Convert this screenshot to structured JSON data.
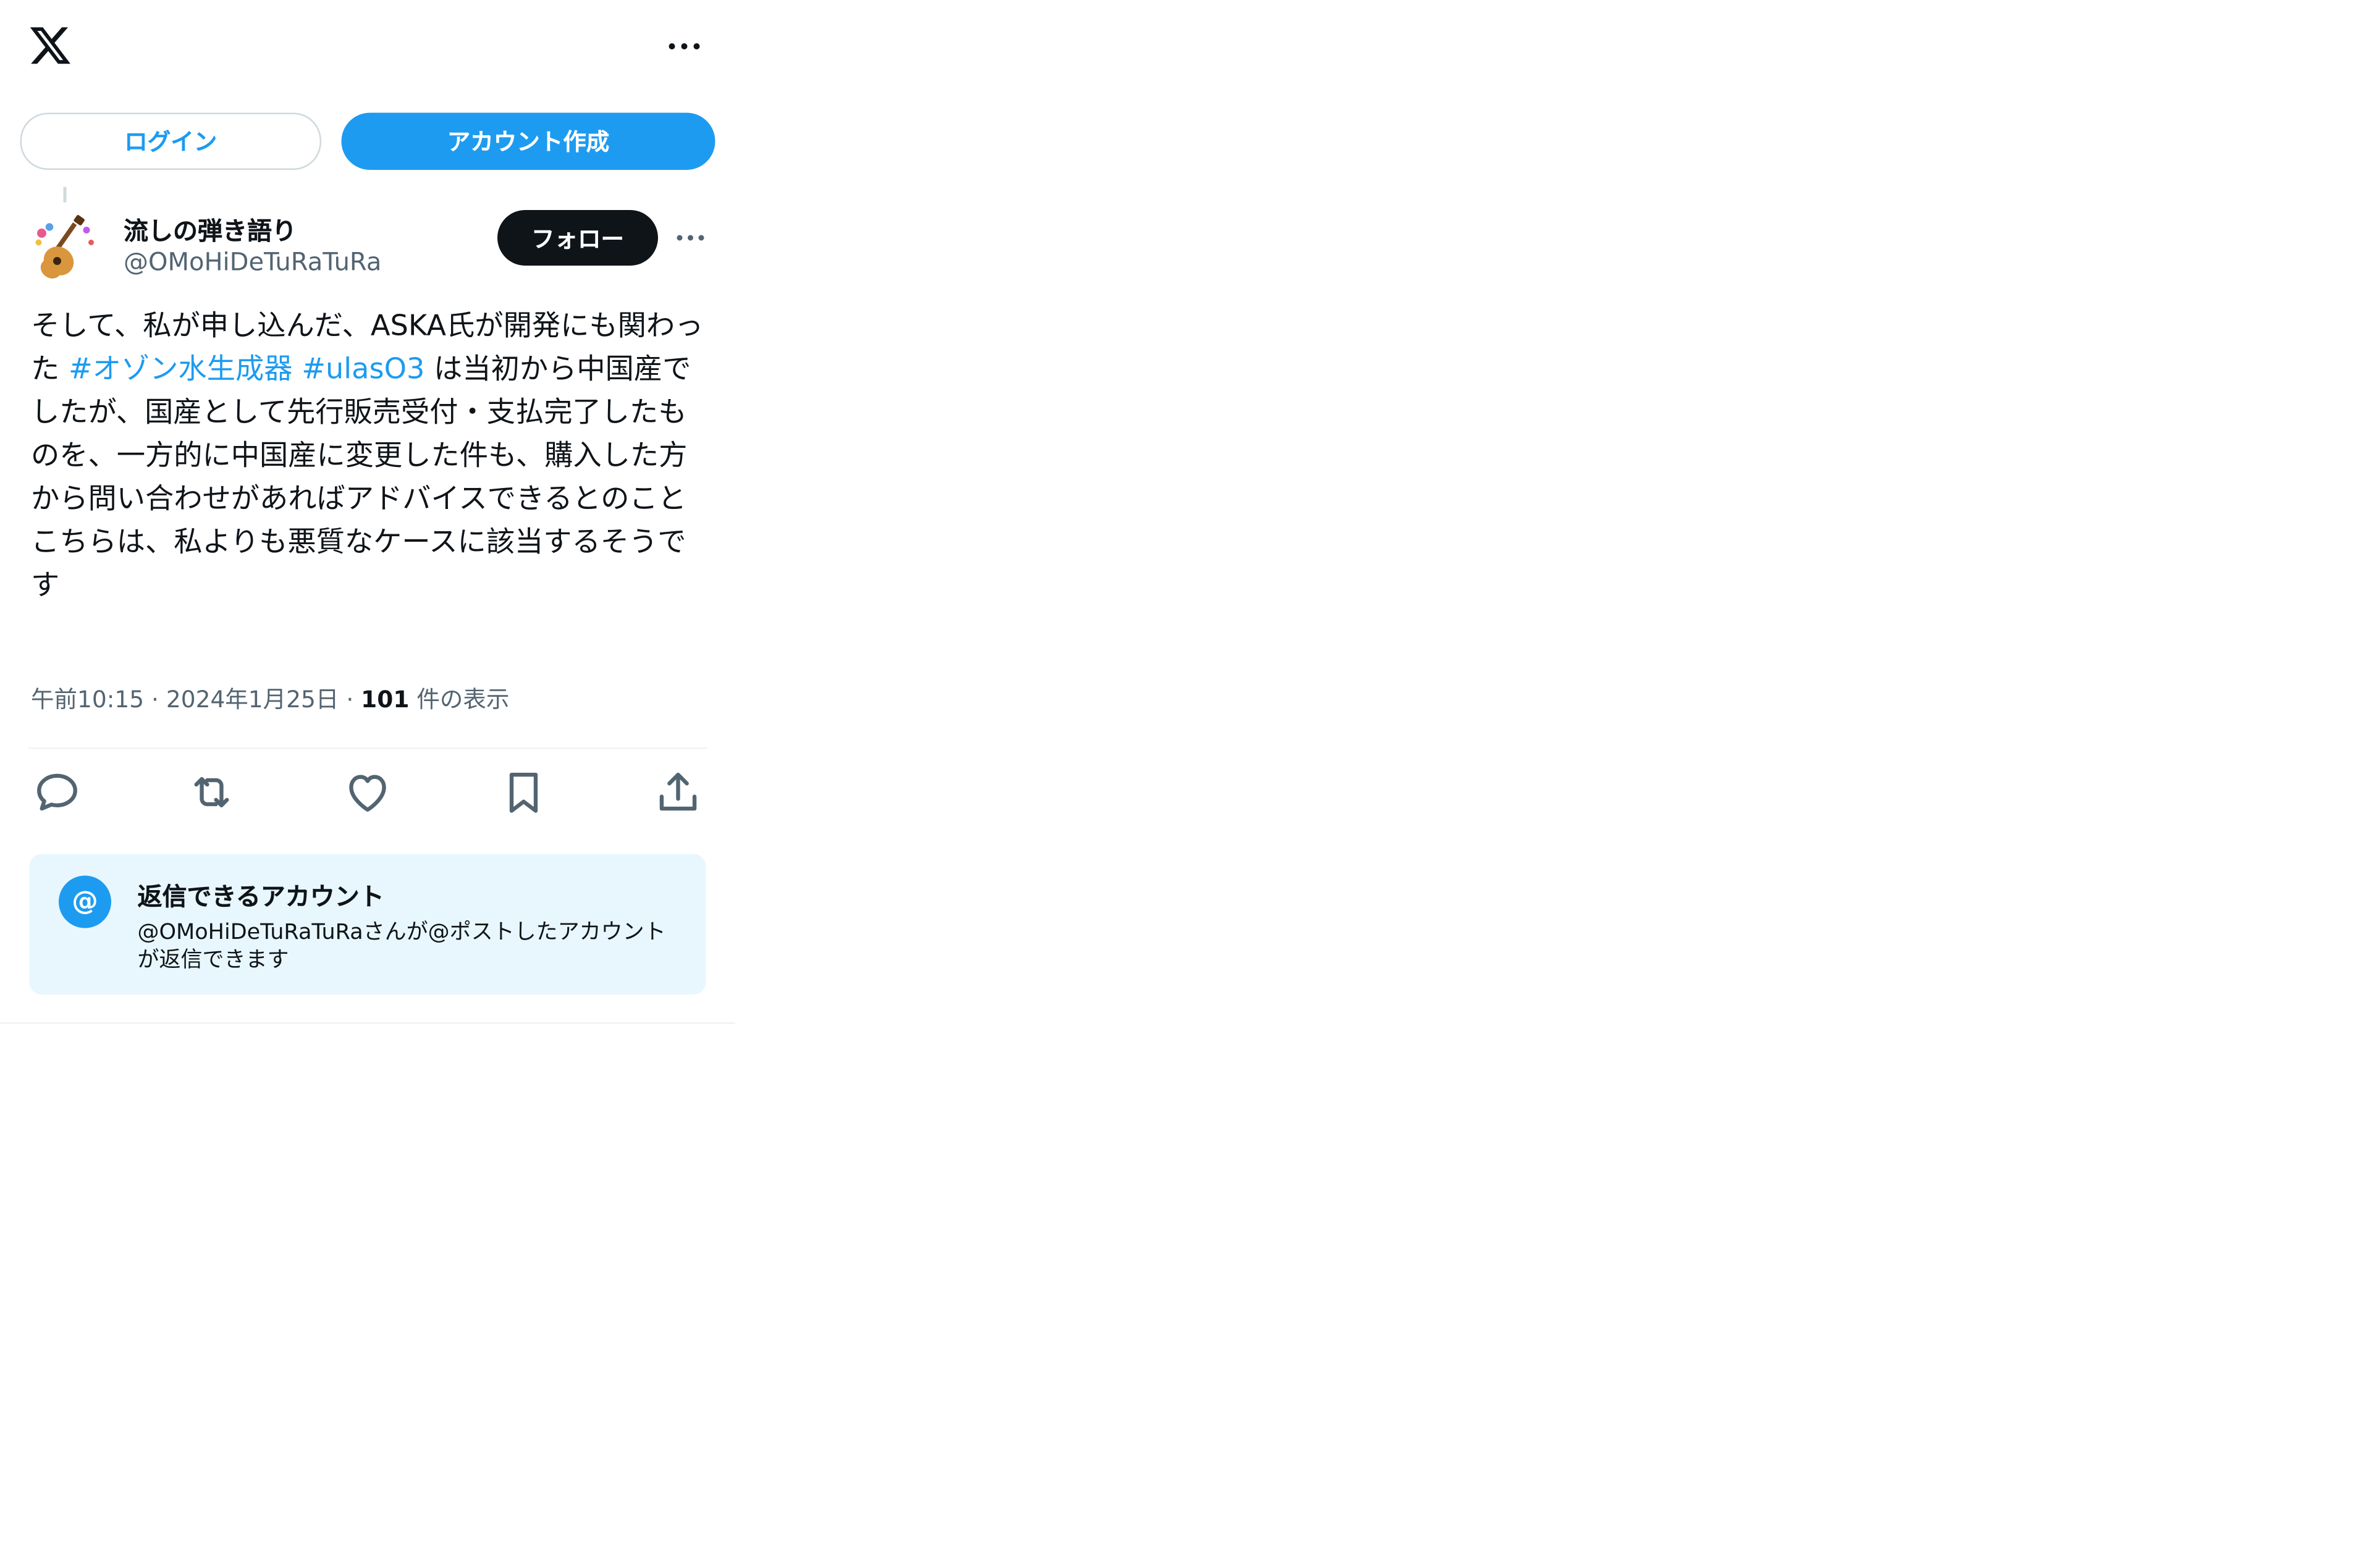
{
  "header": {
    "logo_icon": "x-logo-icon",
    "more_icon": "more-horizontal-icon"
  },
  "auth": {
    "login_label": "ログイン",
    "signup_label": "アカウント作成"
  },
  "author": {
    "display_name": "流しの弾き語り",
    "handle": "@OMoHiDeTuRaTuRa",
    "follow_label": "フォロー",
    "avatar_icon": "guitar-avatar-icon"
  },
  "tweet": {
    "text_part1": "そして、私が申し込んだ、ASKA氏が開発にも関わった ",
    "hashtag1": "#オゾン水生成器",
    "space": " ",
    "hashtag2": "#ulasO3",
    "text_part2": " は当初から中国産でしたが、国産として先行販売受付・支払完了したものを、一方的に中国産に変更した件も、購入した方から問い合わせがあればアドバイスできるとのこと\nこちらは、私よりも悪質なケースに該当するそうです"
  },
  "meta": {
    "time": "午前10:15",
    "sep1": " · ",
    "date": "2024年1月25日",
    "sep2": " · ",
    "views_count": "101",
    "views_label": " 件の表示"
  },
  "actions": {
    "reply_icon": "reply-icon",
    "retweet_icon": "retweet-icon",
    "like_icon": "heart-icon",
    "bookmark_icon": "bookmark-icon",
    "share_icon": "share-icon"
  },
  "reply_restriction": {
    "badge": "@",
    "title": "返信できるアカウント",
    "description": "@OMoHiDeTuRaTuRaさんが@ポストしたアカウントが返信できます"
  },
  "colors": {
    "accent": "#1d9bf0",
    "text_primary": "#0f1419",
    "text_secondary": "#536471",
    "card_bg": "#e8f7fd"
  }
}
